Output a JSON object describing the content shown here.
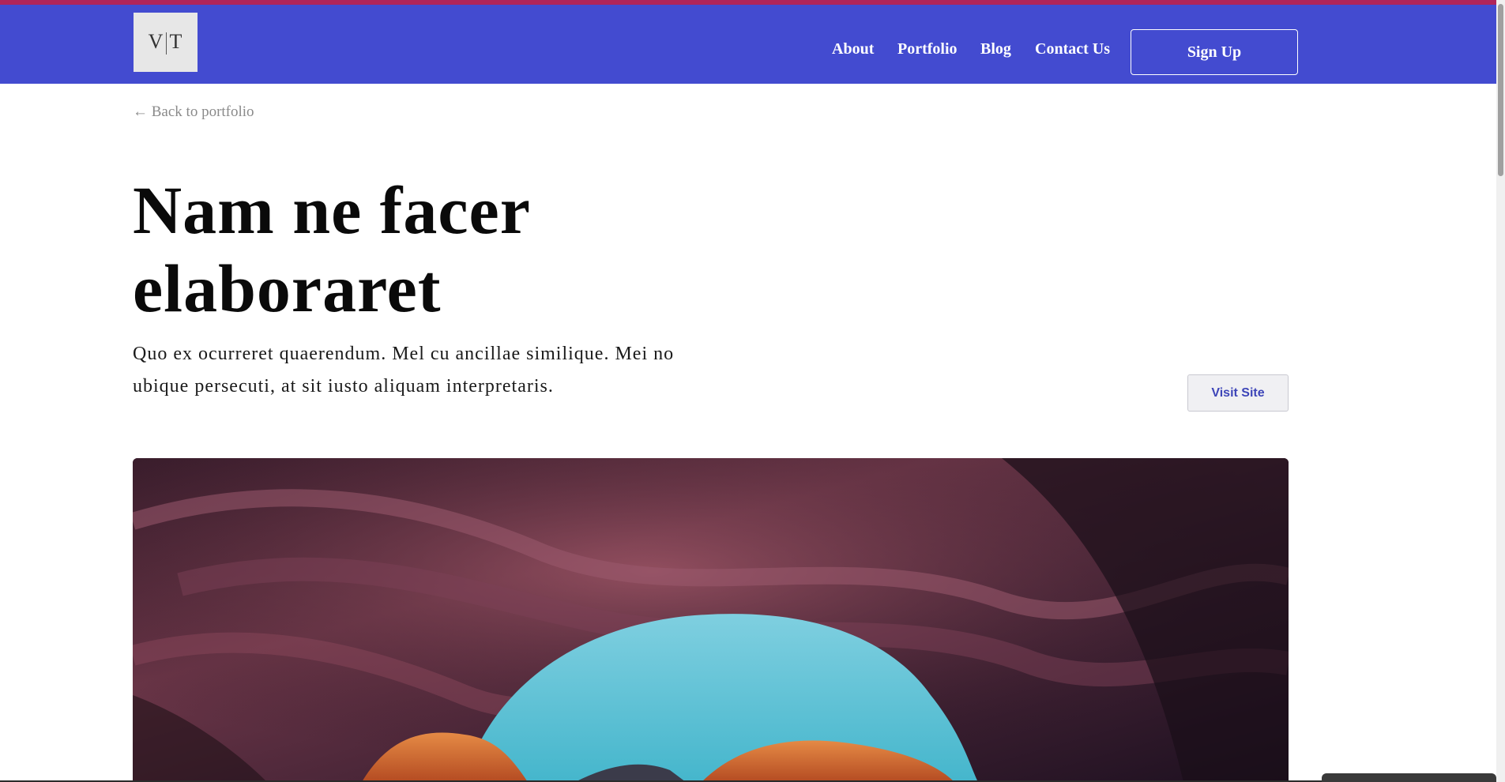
{
  "brand": {
    "logo_text_left": "V",
    "logo_text_right": "T"
  },
  "nav": {
    "links": [
      "About",
      "Portfolio",
      "Blog",
      "Contact Us"
    ],
    "signup_label": "Sign Up"
  },
  "breadcrumb": {
    "back_label": "← Back to portfolio"
  },
  "project": {
    "title_line1": "Nam ne facer",
    "title_line2": "elaboraret",
    "description": "Quo ex ocurreret quaerendum. Mel cu ancillae similique. Mei no ubique persecuti, at sit iusto aliquam interpretaris.",
    "visit_label": "Visit Site"
  },
  "colors": {
    "nav_background": "#434bd0",
    "top_stripe": "#b0245a",
    "visit_text": "#3d45b8"
  }
}
